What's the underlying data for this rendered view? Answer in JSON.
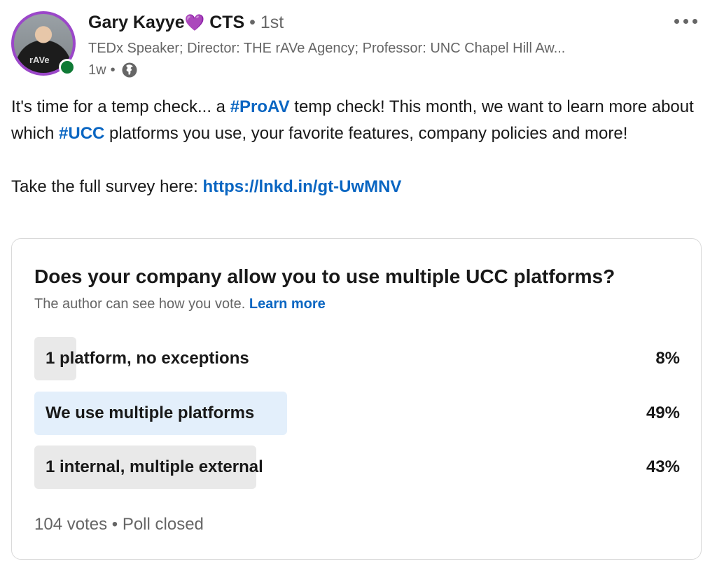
{
  "author": {
    "name": "Gary Kayye",
    "heart": "💜",
    "credential": "CTS",
    "separator": "•",
    "degree": "1st",
    "headline": "TEDx Speaker; Director: THE rAVe Agency; Professor: UNC Chapel Hill Aw...",
    "time": "1w",
    "visibility_icon": "globe-icon",
    "avatar_logo": "rAVe",
    "online_color": "#0f7a35"
  },
  "post": {
    "line1_pre": "It's time for a temp check... a ",
    "hashtag1": "#ProAV",
    "line1_post": " temp check! This month, we want to learn more about which ",
    "hashtag2": "#UCC",
    "line1_end": " platforms you use, your favorite features, company policies and more!",
    "survey_pre": "Take the full survey here: ",
    "survey_link": "https://lnkd.in/gt-UwMNV"
  },
  "poll": {
    "question": "Does your company allow you to use multiple UCC platforms?",
    "note": "The author can see how you vote.",
    "learn_more": "Learn more",
    "options": [
      {
        "label": "1 platform, no exceptions",
        "percent": "8%",
        "value": 8,
        "selected": false
      },
      {
        "label": "We use multiple platforms",
        "percent": "49%",
        "value": 49,
        "selected": true
      },
      {
        "label": "1 internal, multiple external",
        "percent": "43%",
        "value": 43,
        "selected": false
      }
    ],
    "votes": "104 votes",
    "separator": "•",
    "status": "Poll closed"
  },
  "colors": {
    "link": "#0a66c2",
    "option_fill": "#e9e9e9",
    "option_selected": "#e3effb"
  }
}
